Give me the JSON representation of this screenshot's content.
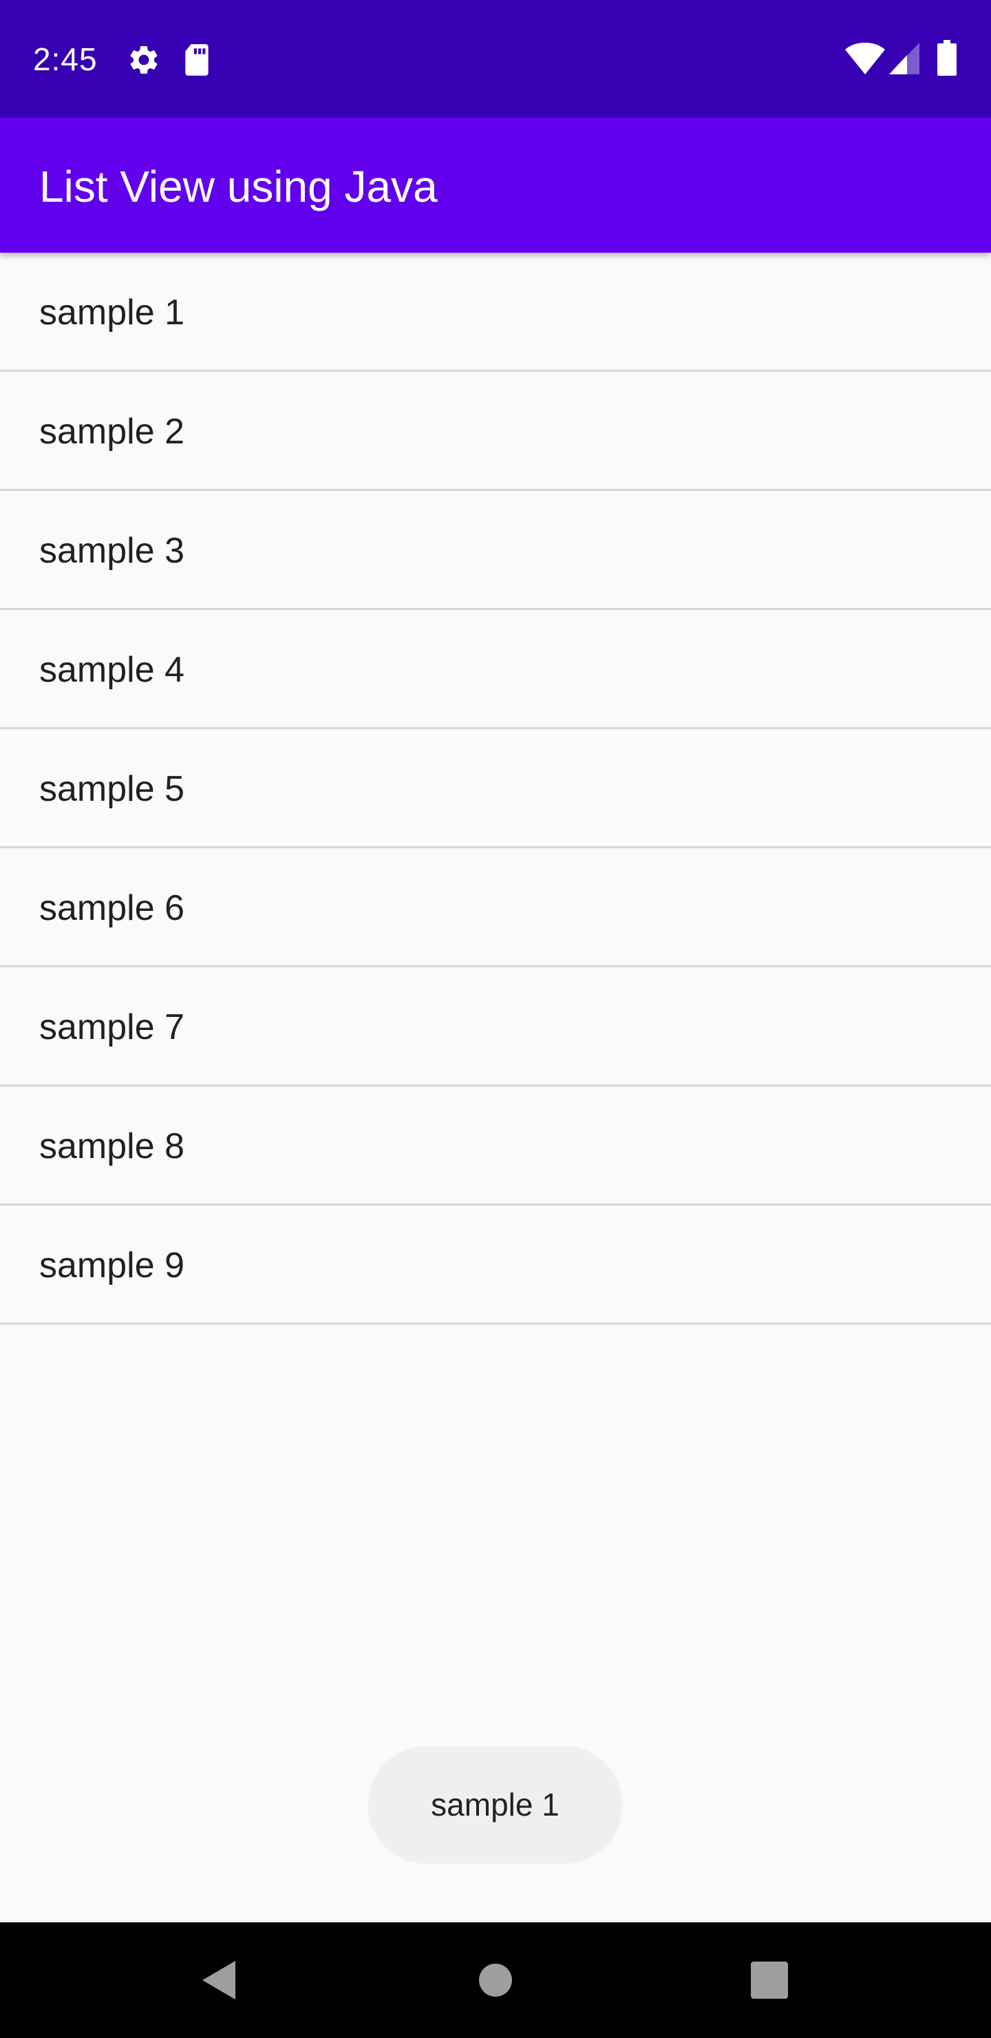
{
  "status_bar": {
    "time": "2:45",
    "background_color": "#3700b3",
    "left_icons": [
      "settings-gear-icon",
      "sd-card-icon"
    ],
    "right_icons": [
      "wifi-icon",
      "cell-signal-icon",
      "battery-icon"
    ]
  },
  "app_bar": {
    "title": "List View using Java",
    "background_color": "#6200ee"
  },
  "list": {
    "items": [
      {
        "label": "sample 1"
      },
      {
        "label": "sample 2"
      },
      {
        "label": "sample 3"
      },
      {
        "label": "sample 4"
      },
      {
        "label": "sample 5"
      },
      {
        "label": "sample 6"
      },
      {
        "label": "sample 7"
      },
      {
        "label": "sample 8"
      },
      {
        "label": "sample 9"
      }
    ]
  },
  "toast": {
    "text": "sample 1"
  },
  "nav_bar": {
    "buttons": [
      {
        "name": "back",
        "icon": "back-triangle-icon"
      },
      {
        "name": "home",
        "icon": "home-circle-icon"
      },
      {
        "name": "recents",
        "icon": "recents-square-icon"
      }
    ]
  }
}
